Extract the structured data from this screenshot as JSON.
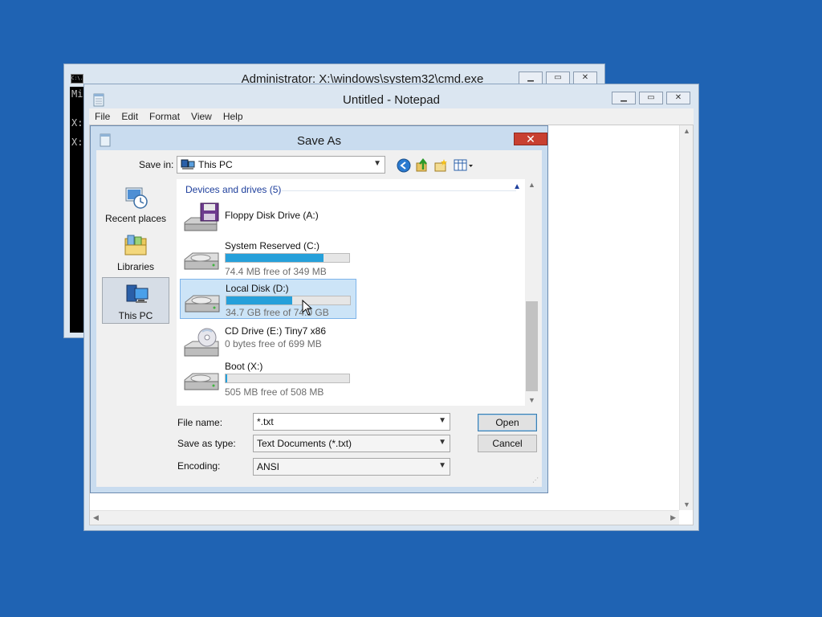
{
  "cmd_window": {
    "title": "Administrator: X:\\windows\\system32\\cmd.exe",
    "icon_label": "C:\\.",
    "lines": [
      "Mi",
      "X:",
      "X:"
    ]
  },
  "notepad": {
    "title": "Untitled - Notepad",
    "menu": [
      "File",
      "Edit",
      "Format",
      "View",
      "Help"
    ]
  },
  "save_dialog": {
    "title": "Save As",
    "save_in_label": "Save in:",
    "save_in_value": "This PC",
    "places": [
      {
        "label": "Recent places"
      },
      {
        "label": "Libraries"
      },
      {
        "label": "This PC"
      }
    ],
    "group_header": "Devices and drives (5)",
    "drives": [
      {
        "name": "Floppy Disk Drive (A:)",
        "free": "",
        "used_fraction": null
      },
      {
        "name": "System Reserved (C:)",
        "free": "74.4 MB free of 349 MB",
        "used_fraction": 0.79
      },
      {
        "name": "Local Disk (D:)",
        "free": "34.7 GB free of 74.0 GB",
        "used_fraction": 0.53
      },
      {
        "name": "CD Drive (E:) Tiny7 x86",
        "free": "0 bytes free of 699 MB",
        "used_fraction": null
      },
      {
        "name": "Boot (X:)",
        "free": "505 MB free of 508 MB",
        "used_fraction": 0.01
      }
    ],
    "file_name_label": "File name:",
    "file_name_value": "*.txt",
    "save_type_label": "Save as type:",
    "save_type_value": "Text Documents (*.txt)",
    "encoding_label": "Encoding:",
    "encoding_value": "ANSI",
    "open_label": "Open",
    "cancel_label": "Cancel"
  },
  "colors": {
    "desktop": "#1f63b3",
    "progress_fill": "#26a0da",
    "selection": "#cce4f7",
    "close_button": "#c84031"
  }
}
